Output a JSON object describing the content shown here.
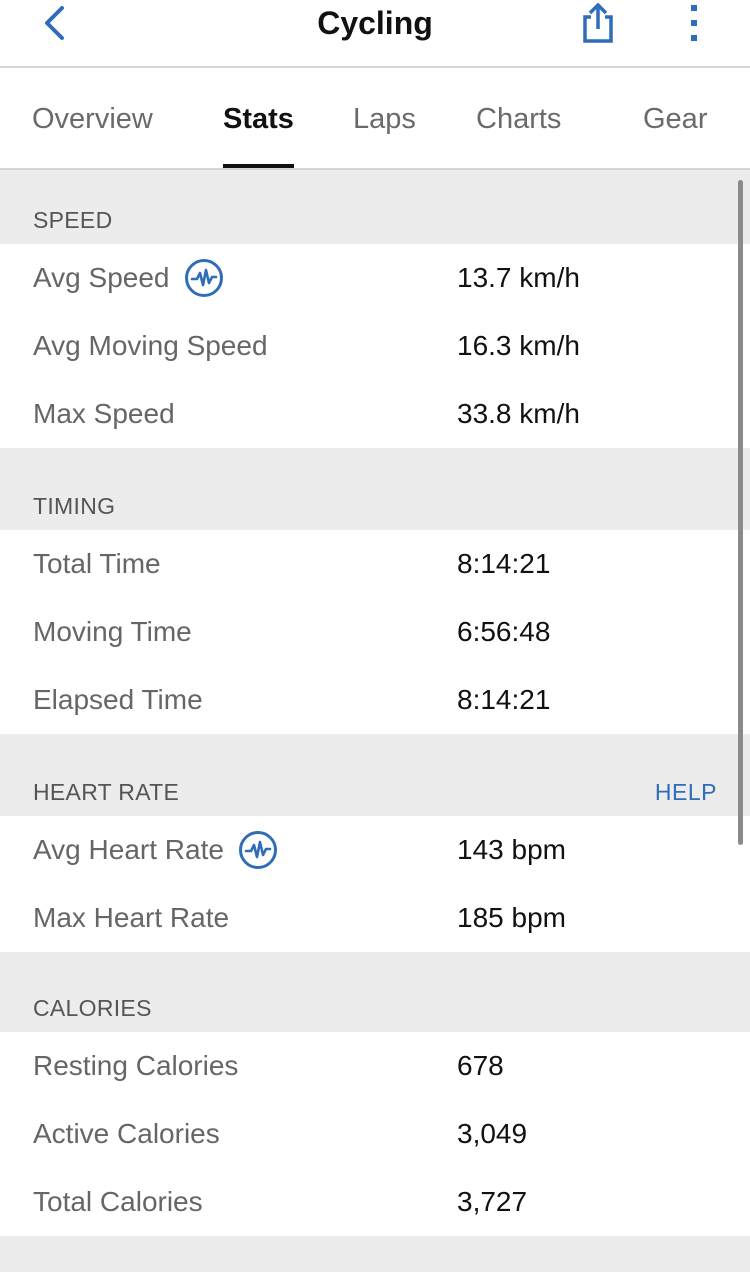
{
  "header": {
    "title": "Cycling",
    "back_icon": "chevron-left-icon",
    "share_icon": "share-icon",
    "more_icon": "more-vertical-icon"
  },
  "tabs": [
    {
      "label": "Overview",
      "active": false
    },
    {
      "label": "Stats",
      "active": true
    },
    {
      "label": "Laps",
      "active": false
    },
    {
      "label": "Charts",
      "active": false
    },
    {
      "label": "Gear",
      "active": false
    }
  ],
  "sections": {
    "speed": {
      "title": "SPEED",
      "rows": [
        {
          "label": "Avg Speed",
          "value": "13.7 km/h",
          "icon": "pulse-chart-icon"
        },
        {
          "label": "Avg Moving Speed",
          "value": "16.3 km/h"
        },
        {
          "label": "Max Speed",
          "value": "33.8 km/h"
        }
      ]
    },
    "timing": {
      "title": "TIMING",
      "rows": [
        {
          "label": "Total Time",
          "value": "8:14:21"
        },
        {
          "label": "Moving Time",
          "value": "6:56:48"
        },
        {
          "label": "Elapsed Time",
          "value": "8:14:21"
        }
      ]
    },
    "heart_rate": {
      "title": "HEART RATE",
      "help": "HELP",
      "rows": [
        {
          "label": "Avg Heart Rate",
          "value": "143 bpm",
          "icon": "pulse-chart-icon"
        },
        {
          "label": "Max Heart Rate",
          "value": "185 bpm"
        }
      ]
    },
    "calories": {
      "title": "CALORIES",
      "rows": [
        {
          "label": "Resting Calories",
          "value": "678"
        },
        {
          "label": "Active Calories",
          "value": "3,049"
        },
        {
          "label": "Total Calories",
          "value": "3,727"
        }
      ]
    }
  },
  "colors": {
    "accent": "#2f6db8",
    "section_bg": "#ececec",
    "row_bg": "#ffffff"
  }
}
